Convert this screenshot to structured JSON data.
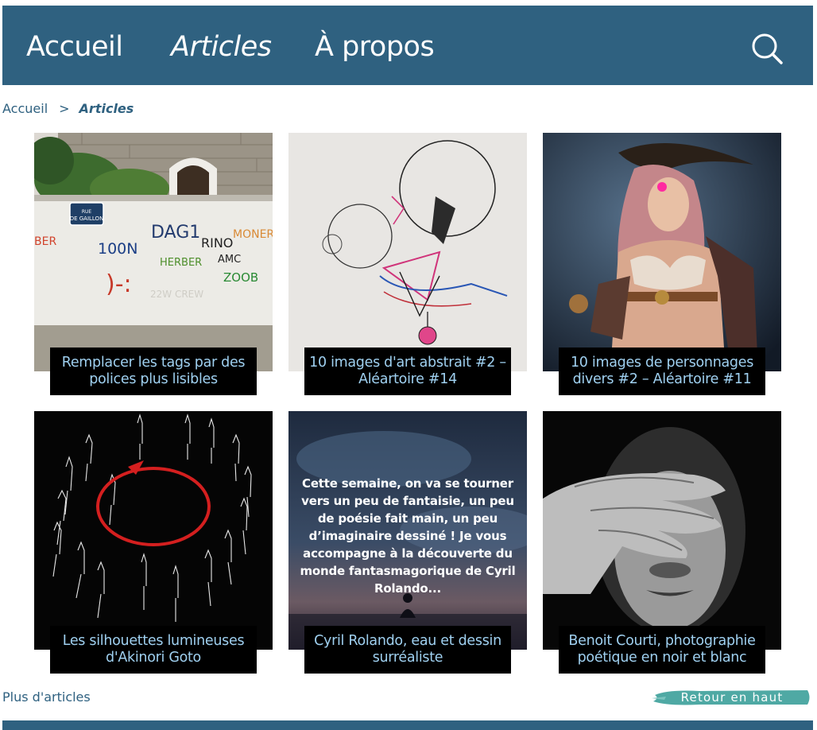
{
  "nav": {
    "home": "Accueil",
    "articles": "Articles",
    "about": "À propos",
    "search_icon": "search-icon"
  },
  "breadcrumb": {
    "home": "Accueil",
    "separator": ">",
    "current": "Articles"
  },
  "cards": [
    {
      "title": "Remplacer les tags par des polices plus lisibles",
      "image_text": {
        "street_sign": "RUE DE GAILLON",
        "tags": [
          "DAG1",
          "RINO",
          "MONER",
          "100N",
          "HERBER",
          "AMC",
          "ZOOB",
          "BER",
          ")-:",
          "22W CREW"
        ]
      }
    },
    {
      "title": "10 images d'art abstrait #2 – Aléartoire #14"
    },
    {
      "title": "10 images de personnages divers #2 – Aléartoire #11"
    },
    {
      "title": "Les silhouettes lumineuses d'Akinori Goto"
    },
    {
      "title": "Cyril Rolando, eau et dessin surréaliste",
      "excerpt": "Cette semaine, on va se tourner vers un peu de fantaisie, un peu de poésie fait main, un peu d’imaginaire dessiné ! Je vous accompagne à la découverte du monde fantasmagorique de Cyril Rolando..."
    },
    {
      "title": "Benoit Courti, photographie poétique en noir et blanc"
    }
  ],
  "footer": {
    "more": "Plus d'articles",
    "back_to_top": "Retour en haut"
  },
  "colors": {
    "brand": "#2f6180",
    "caption_bg": "#000000",
    "caption_text": "#9fd0f0",
    "back_top_brush": "#4fa9a4"
  }
}
